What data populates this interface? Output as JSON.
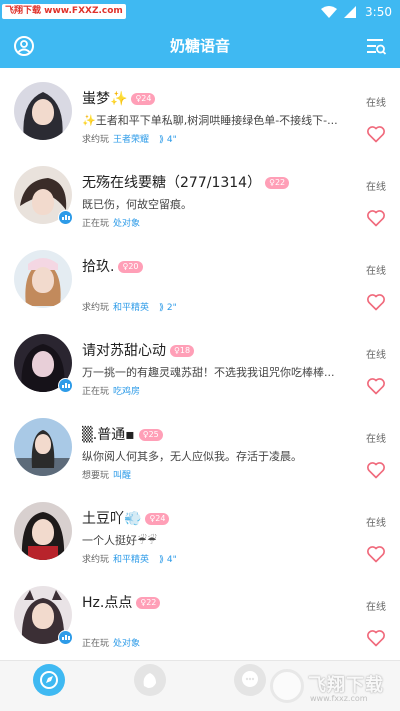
{
  "status_bar": {
    "time": "3:50",
    "watermark_badge": "飞翔下载 www.FXXZ.com"
  },
  "app_bar": {
    "title": "奶糖语音",
    "left_icon": "profile-icon",
    "right_icon": "filter-list-icon"
  },
  "colors": {
    "accent": "#3fb9f2",
    "link": "#2d9be8",
    "age_badge": "#ff9fb7",
    "heart": "#f06a7c"
  },
  "users": [
    {
      "name": "蚩梦✨",
      "age": "24",
      "status": "在线",
      "signature": "✨王者和平下单私聊,树洞哄睡接绿色单-不接线下-...",
      "activity_label": "求约玩",
      "activity_game": "王者荣耀",
      "voice": "4\"",
      "live": false
    },
    {
      "name": "无殇在线要糖（277/1314）",
      "age": "22",
      "status": "在线",
      "signature": "既已伤，何故空留痕。",
      "activity_label": "正在玩",
      "activity_game": "处对象",
      "voice": "",
      "live": true
    },
    {
      "name": "拾玖.",
      "age": "20",
      "status": "在线",
      "signature": "",
      "activity_label": "求约玩",
      "activity_game": "和平精英",
      "voice": "2\"",
      "live": false
    },
    {
      "name": "请对苏甜心动",
      "age": "18",
      "status": "在线",
      "signature": "万一挑一的有趣灵魂苏甜！不选我我诅咒你吃棒棒...",
      "activity_label": "正在玩",
      "activity_game": "吃鸡房",
      "voice": "",
      "live": true
    },
    {
      "name": "▒.普通▪",
      "age": "25",
      "status": "在线",
      "signature": "纵你阅人何其多，无人应似我。存活于凌晨。",
      "activity_label": "想要玩",
      "activity_game": "叫醒",
      "voice": "",
      "live": false
    },
    {
      "name": "土豆吖💨",
      "age": "24",
      "status": "在线",
      "signature": "一个人挺好☔☔",
      "activity_label": "求约玩",
      "activity_game": "和平精英",
      "voice": "4\"",
      "live": false
    },
    {
      "name": "Hz.点点",
      "age": "22",
      "status": "在线",
      "signature": "",
      "activity_label": "正在玩",
      "activity_game": "处对象",
      "voice": "",
      "live": true
    }
  ],
  "bottom_tabs": [
    {
      "icon": "compass-icon",
      "active": true
    },
    {
      "icon": "bubble-icon",
      "active": false
    },
    {
      "icon": "chat-icon",
      "active": false
    }
  ],
  "watermark": {
    "text": "飞翔下载",
    "url": "www.fxxz.com"
  }
}
